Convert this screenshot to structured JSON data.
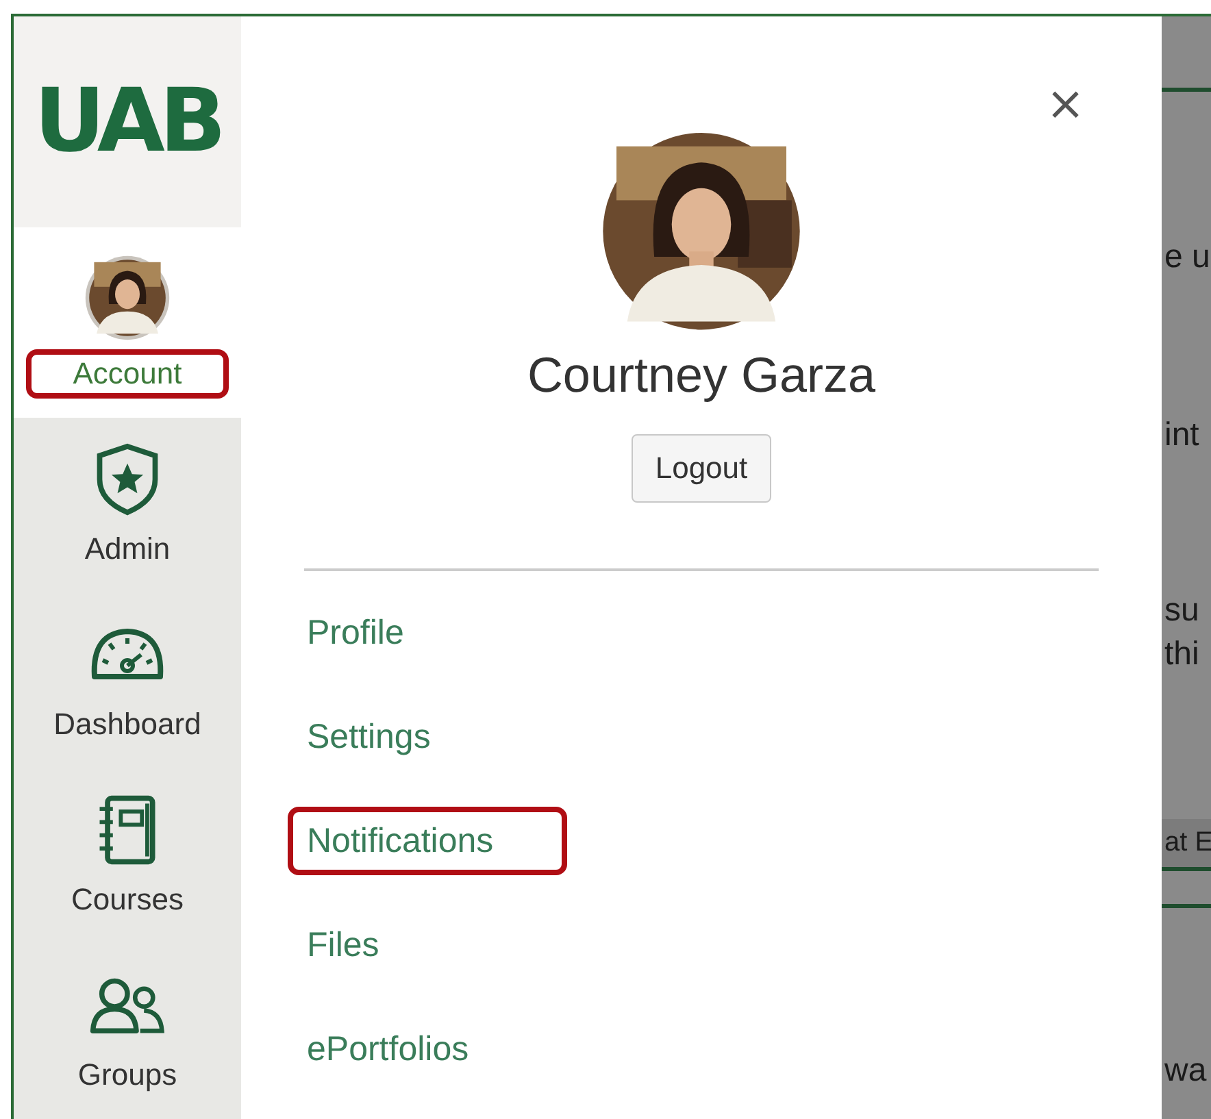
{
  "logo": {
    "text": "UAB"
  },
  "nav": [
    {
      "label": "Account",
      "kind": "account",
      "selected": true,
      "highlighted": true
    },
    {
      "label": "Admin",
      "kind": "admin",
      "selected": false,
      "highlighted": false
    },
    {
      "label": "Dashboard",
      "kind": "dashboard",
      "selected": false,
      "highlighted": false
    },
    {
      "label": "Courses",
      "kind": "courses",
      "selected": false,
      "highlighted": false
    },
    {
      "label": "Groups",
      "kind": "groups",
      "selected": false,
      "highlighted": false
    }
  ],
  "tray": {
    "close": "×",
    "name": "Courtney Garza",
    "logout": "Logout",
    "links": [
      {
        "label": "Profile",
        "highlighted": false
      },
      {
        "label": "Settings",
        "highlighted": false
      },
      {
        "label": "Notifications",
        "highlighted": true
      },
      {
        "label": "Files",
        "highlighted": false
      },
      {
        "label": "ePortfolios",
        "highlighted": false
      }
    ]
  },
  "background_page": {
    "fragments": [
      "e u",
      "int",
      "su",
      "thi",
      "at E",
      "wa"
    ]
  }
}
